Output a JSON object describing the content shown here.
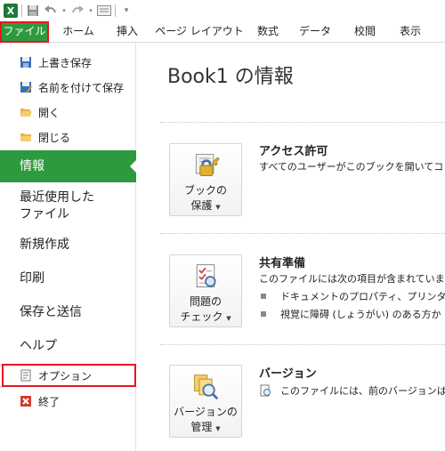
{
  "quick_access": {
    "icons": [
      "excel-app-icon",
      "save-icon",
      "undo-icon",
      "redo-icon",
      "form-icon",
      "customize-icon"
    ]
  },
  "ribbon": {
    "tabs": [
      "ファイル",
      "ホーム",
      "挿入",
      "ページ レイアウト",
      "数式",
      "データ",
      "校閲",
      "表示"
    ]
  },
  "nav": {
    "commands": [
      "上書き保存",
      "名前を付けて保存",
      "開く",
      "閉じる"
    ],
    "info": "情報",
    "recent": "最近使用した\nファイル",
    "new": "新規作成",
    "print": "印刷",
    "save_send": "保存と送信",
    "help": "ヘルプ",
    "options": "オプション",
    "exit": "終了"
  },
  "main": {
    "title": "Book1 の情報",
    "permissions": {
      "button_line1": "ブックの",
      "button_line2": "保護",
      "heading": "アクセス許可",
      "text": "すべてのユーザーがこのブックを開いてコピ"
    },
    "prepare": {
      "button_line1": "問題の",
      "button_line2": "チェック",
      "heading": "共有準備",
      "text": "このファイルには次の項目が含まれていま",
      "bullets": [
        "ドキュメントのプロパティ、プリンターの",
        "視覚に障碍 (しょうがい) のある方か"
      ]
    },
    "versions": {
      "button_line1": "バージョンの",
      "button_line2": "管理",
      "heading": "バージョン",
      "text": "このファイルには、前のバージョンはあ"
    }
  },
  "colors": {
    "accent_green": "#2e9a3f",
    "highlight_red": "#e8151c"
  }
}
